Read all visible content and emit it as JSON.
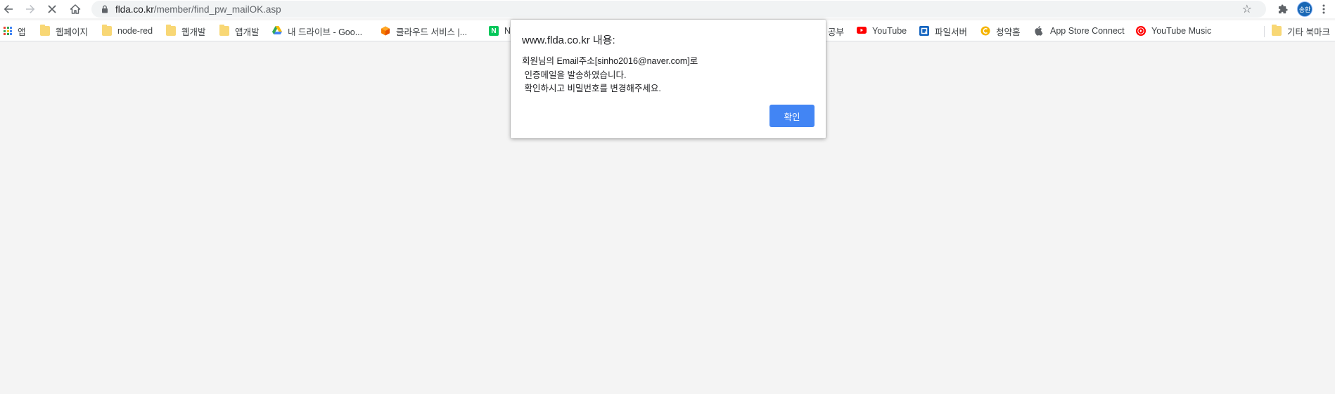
{
  "window": {
    "url_host": "flda.co.kr",
    "url_path": "/member/find_pw_mailOK.asp",
    "profile_initials": "송환"
  },
  "icons": {
    "back": "back-arrow-icon",
    "forward": "forward-arrow-icon",
    "stop": "stop-loading-icon",
    "home": "home-icon",
    "lock": "lock-icon",
    "star": "bookmark-star-icon",
    "extensions": "puzzle-icon",
    "menu": "kebab-menu-icon"
  },
  "bookmarks": {
    "apps": "앱",
    "items": [
      "웹페이지",
      "node-red",
      "웹개발",
      "앱개발",
      "내 드라이브 - Goo...",
      "클라우드 서비스 |...",
      "N",
      "공부",
      "YouTube",
      "파일서버",
      "청약홈",
      "App Store Connect",
      "YouTube Music"
    ],
    "other": "기타 북마크"
  },
  "colors": {
    "accent": "#4285f4",
    "background": "#f4f4f4",
    "youtube": "#ff0000",
    "folder": "#f8d775"
  },
  "dialog": {
    "title": "www.flda.co.kr 내용:",
    "message": "회원님의 Email주소[sinho2016@naver.com]로\n 인증메일을 발송하였습니다.\n 확인하시고 비밀번호를 변경해주세요.",
    "ok_label": "확인"
  }
}
